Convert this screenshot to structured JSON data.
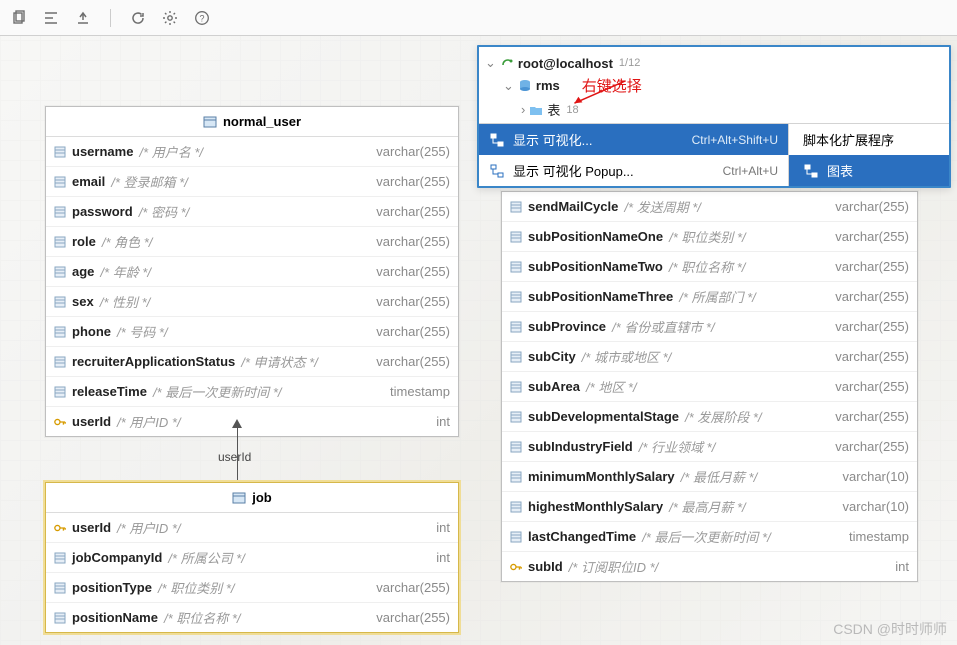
{
  "toolbar": {
    "icons": [
      "copy",
      "layout",
      "export",
      "refresh",
      "settings",
      "help"
    ]
  },
  "tree": {
    "root": "root@localhost",
    "root_count": "1/12",
    "db": "rms",
    "tables_label": "表",
    "tables_count": "18",
    "annotation": "右键选择"
  },
  "context_menu": {
    "left": [
      {
        "label": "显示 可视化...",
        "shortcut": "Ctrl+Alt+Shift+U",
        "selected": true
      },
      {
        "label": "显示 可视化 Popup...",
        "shortcut": "Ctrl+Alt+U",
        "selected": false
      }
    ],
    "right": [
      {
        "label": "脚本化扩展程序",
        "selected": false
      },
      {
        "label": "图表",
        "selected": true
      }
    ]
  },
  "entities": {
    "normal_user": {
      "title": "normal_user",
      "columns": [
        {
          "name": "username",
          "comment": "/* 用户名 */",
          "type": "varchar(255)",
          "key": false
        },
        {
          "name": "email",
          "comment": "/* 登录邮箱 */",
          "type": "varchar(255)",
          "key": false
        },
        {
          "name": "password",
          "comment": "/* 密码 */",
          "type": "varchar(255)",
          "key": false
        },
        {
          "name": "role",
          "comment": "/* 角色 */",
          "type": "varchar(255)",
          "key": false
        },
        {
          "name": "age",
          "comment": "/* 年龄 */",
          "type": "varchar(255)",
          "key": false
        },
        {
          "name": "sex",
          "comment": "/* 性别 */",
          "type": "varchar(255)",
          "key": false
        },
        {
          "name": "phone",
          "comment": "/* 号码 */",
          "type": "varchar(255)",
          "key": false
        },
        {
          "name": "recruiterApplicationStatus",
          "comment": "/* 申请状态 */",
          "type": "varchar(255)",
          "key": false
        },
        {
          "name": "releaseTime",
          "comment": "/* 最后一次更新时间 */",
          "type": "timestamp",
          "key": false
        },
        {
          "name": "userId",
          "comment": "/* 用户ID */",
          "type": "int",
          "key": true
        }
      ]
    },
    "job": {
      "title": "job",
      "columns": [
        {
          "name": "userId",
          "comment": "/* 用户ID */",
          "type": "int",
          "key": true
        },
        {
          "name": "jobCompanyId",
          "comment": "/* 所属公司 */",
          "type": "int",
          "key": false
        },
        {
          "name": "positionType",
          "comment": "/* 职位类别 */",
          "type": "varchar(255)",
          "key": false
        },
        {
          "name": "positionName",
          "comment": "/* 职位名称 */",
          "type": "varchar(255)",
          "key": false
        }
      ]
    },
    "sub": {
      "columns": [
        {
          "name": "sendMailCycle",
          "comment": "/* 发送周期 */",
          "type": "varchar(255)",
          "key": false
        },
        {
          "name": "subPositionNameOne",
          "comment": "/* 职位类别 */",
          "type": "varchar(255)",
          "key": false
        },
        {
          "name": "subPositionNameTwo",
          "comment": "/* 职位名称 */",
          "type": "varchar(255)",
          "key": false
        },
        {
          "name": "subPositionNameThree",
          "comment": "/* 所属部门 */",
          "type": "varchar(255)",
          "key": false
        },
        {
          "name": "subProvince",
          "comment": "/* 省份或直辖市 */",
          "type": "varchar(255)",
          "key": false
        },
        {
          "name": "subCity",
          "comment": "/* 城市或地区 */",
          "type": "varchar(255)",
          "key": false
        },
        {
          "name": "subArea",
          "comment": "/* 地区 */",
          "type": "varchar(255)",
          "key": false
        },
        {
          "name": "subDevelopmentalStage",
          "comment": "/* 发展阶段 */",
          "type": "varchar(255)",
          "key": false
        },
        {
          "name": "subIndustryField",
          "comment": "/* 行业领域 */",
          "type": "varchar(255)",
          "key": false
        },
        {
          "name": "minimumMonthlySalary",
          "comment": "/* 最低月薪 */",
          "type": "varchar(10)",
          "key": false
        },
        {
          "name": "highestMonthlySalary",
          "comment": "/* 最高月薪 */",
          "type": "varchar(10)",
          "key": false
        },
        {
          "name": "lastChangedTime",
          "comment": "/* 最后一次更新时间 */",
          "type": "timestamp",
          "key": false
        },
        {
          "name": "subId",
          "comment": "/* 订阅职位ID */",
          "type": "int",
          "key": true
        }
      ]
    }
  },
  "relation": {
    "label": "userId"
  },
  "watermark": "CSDN @时时师师"
}
